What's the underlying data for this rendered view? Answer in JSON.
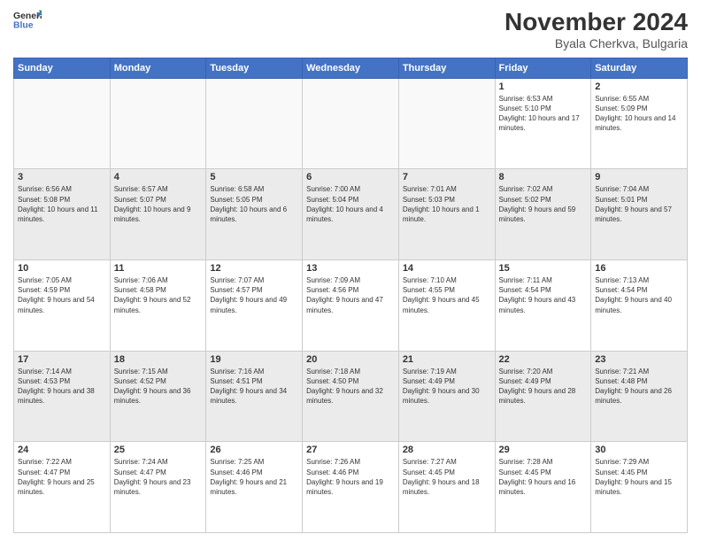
{
  "header": {
    "logo_line1": "General",
    "logo_line2": "Blue",
    "month": "November 2024",
    "location": "Byala Cherkva, Bulgaria"
  },
  "weekdays": [
    "Sunday",
    "Monday",
    "Tuesday",
    "Wednesday",
    "Thursday",
    "Friday",
    "Saturday"
  ],
  "rows": [
    [
      {
        "day": "",
        "info": ""
      },
      {
        "day": "",
        "info": ""
      },
      {
        "day": "",
        "info": ""
      },
      {
        "day": "",
        "info": ""
      },
      {
        "day": "",
        "info": ""
      },
      {
        "day": "1",
        "info": "Sunrise: 6:53 AM\nSunset: 5:10 PM\nDaylight: 10 hours and 17 minutes."
      },
      {
        "day": "2",
        "info": "Sunrise: 6:55 AM\nSunset: 5:09 PM\nDaylight: 10 hours and 14 minutes."
      }
    ],
    [
      {
        "day": "3",
        "info": "Sunrise: 6:56 AM\nSunset: 5:08 PM\nDaylight: 10 hours and 11 minutes."
      },
      {
        "day": "4",
        "info": "Sunrise: 6:57 AM\nSunset: 5:07 PM\nDaylight: 10 hours and 9 minutes."
      },
      {
        "day": "5",
        "info": "Sunrise: 6:58 AM\nSunset: 5:05 PM\nDaylight: 10 hours and 6 minutes."
      },
      {
        "day": "6",
        "info": "Sunrise: 7:00 AM\nSunset: 5:04 PM\nDaylight: 10 hours and 4 minutes."
      },
      {
        "day": "7",
        "info": "Sunrise: 7:01 AM\nSunset: 5:03 PM\nDaylight: 10 hours and 1 minute."
      },
      {
        "day": "8",
        "info": "Sunrise: 7:02 AM\nSunset: 5:02 PM\nDaylight: 9 hours and 59 minutes."
      },
      {
        "day": "9",
        "info": "Sunrise: 7:04 AM\nSunset: 5:01 PM\nDaylight: 9 hours and 57 minutes."
      }
    ],
    [
      {
        "day": "10",
        "info": "Sunrise: 7:05 AM\nSunset: 4:59 PM\nDaylight: 9 hours and 54 minutes."
      },
      {
        "day": "11",
        "info": "Sunrise: 7:06 AM\nSunset: 4:58 PM\nDaylight: 9 hours and 52 minutes."
      },
      {
        "day": "12",
        "info": "Sunrise: 7:07 AM\nSunset: 4:57 PM\nDaylight: 9 hours and 49 minutes."
      },
      {
        "day": "13",
        "info": "Sunrise: 7:09 AM\nSunset: 4:56 PM\nDaylight: 9 hours and 47 minutes."
      },
      {
        "day": "14",
        "info": "Sunrise: 7:10 AM\nSunset: 4:55 PM\nDaylight: 9 hours and 45 minutes."
      },
      {
        "day": "15",
        "info": "Sunrise: 7:11 AM\nSunset: 4:54 PM\nDaylight: 9 hours and 43 minutes."
      },
      {
        "day": "16",
        "info": "Sunrise: 7:13 AM\nSunset: 4:54 PM\nDaylight: 9 hours and 40 minutes."
      }
    ],
    [
      {
        "day": "17",
        "info": "Sunrise: 7:14 AM\nSunset: 4:53 PM\nDaylight: 9 hours and 38 minutes."
      },
      {
        "day": "18",
        "info": "Sunrise: 7:15 AM\nSunset: 4:52 PM\nDaylight: 9 hours and 36 minutes."
      },
      {
        "day": "19",
        "info": "Sunrise: 7:16 AM\nSunset: 4:51 PM\nDaylight: 9 hours and 34 minutes."
      },
      {
        "day": "20",
        "info": "Sunrise: 7:18 AM\nSunset: 4:50 PM\nDaylight: 9 hours and 32 minutes."
      },
      {
        "day": "21",
        "info": "Sunrise: 7:19 AM\nSunset: 4:49 PM\nDaylight: 9 hours and 30 minutes."
      },
      {
        "day": "22",
        "info": "Sunrise: 7:20 AM\nSunset: 4:49 PM\nDaylight: 9 hours and 28 minutes."
      },
      {
        "day": "23",
        "info": "Sunrise: 7:21 AM\nSunset: 4:48 PM\nDaylight: 9 hours and 26 minutes."
      }
    ],
    [
      {
        "day": "24",
        "info": "Sunrise: 7:22 AM\nSunset: 4:47 PM\nDaylight: 9 hours and 25 minutes."
      },
      {
        "day": "25",
        "info": "Sunrise: 7:24 AM\nSunset: 4:47 PM\nDaylight: 9 hours and 23 minutes."
      },
      {
        "day": "26",
        "info": "Sunrise: 7:25 AM\nSunset: 4:46 PM\nDaylight: 9 hours and 21 minutes."
      },
      {
        "day": "27",
        "info": "Sunrise: 7:26 AM\nSunset: 4:46 PM\nDaylight: 9 hours and 19 minutes."
      },
      {
        "day": "28",
        "info": "Sunrise: 7:27 AM\nSunset: 4:45 PM\nDaylight: 9 hours and 18 minutes."
      },
      {
        "day": "29",
        "info": "Sunrise: 7:28 AM\nSunset: 4:45 PM\nDaylight: 9 hours and 16 minutes."
      },
      {
        "day": "30",
        "info": "Sunrise: 7:29 AM\nSunset: 4:45 PM\nDaylight: 9 hours and 15 minutes."
      }
    ]
  ]
}
